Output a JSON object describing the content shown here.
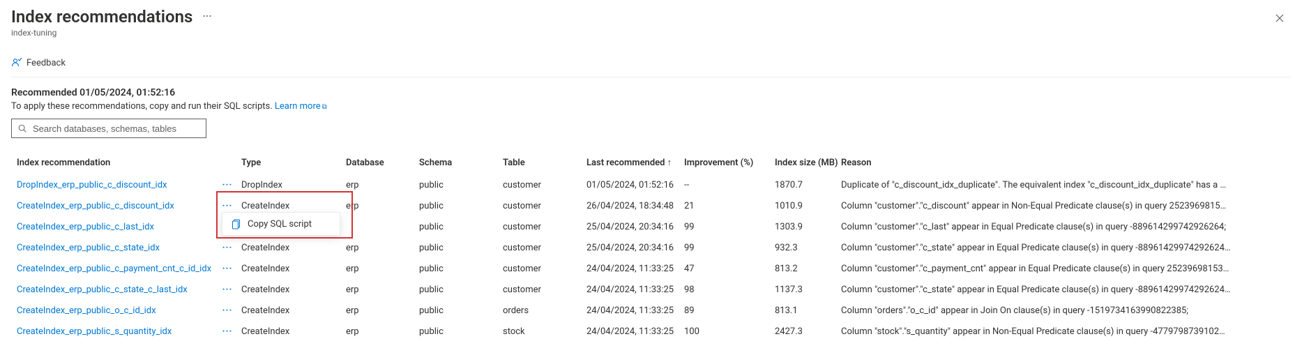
{
  "header": {
    "title": "Index recommendations",
    "subtitle": "index-tuning",
    "feedback_label": "Feedback",
    "close_label": "Close"
  },
  "summary": {
    "recommended_prefix": "Recommended ",
    "recommended_timestamp": "01/05/2024, 01:52:16",
    "apply_text": "To apply these recommendations, copy and run their SQL scripts. ",
    "learn_more_label": "Learn more"
  },
  "search": {
    "placeholder": "Search databases, schemas, tables",
    "value": ""
  },
  "columns": {
    "name": "Index recommendation",
    "type": "Type",
    "database": "Database",
    "schema": "Schema",
    "table": "Table",
    "last_recommended": "Last recommended ↑",
    "improvement": "Improvement (%)",
    "index_size": "Index size (MB)",
    "reason": "Reason"
  },
  "context_menu": {
    "copy_sql": "Copy SQL script"
  },
  "rows": [
    {
      "name": "DropIndex_erp_public_c_discount_idx",
      "type": "DropIndex",
      "database": "erp",
      "schema": "public",
      "table": "customer",
      "last": "01/05/2024, 01:52:16",
      "improvement": "--",
      "size": "1870.7",
      "reason": "Duplicate of \"c_discount_idx_duplicate\". The equivalent index \"c_discount_idx_duplicate\" has a …"
    },
    {
      "name": "CreateIndex_erp_public_c_discount_idx",
      "type": "CreateIndex",
      "database": "erp",
      "schema": "public",
      "table": "customer",
      "last": "26/04/2024, 18:34:48",
      "improvement": "21",
      "size": "1010.9",
      "reason": "Column \"customer\".\"c_discount\" appear in Non-Equal Predicate clause(s) in query 2523969815…"
    },
    {
      "name": "CreateIndex_erp_public_c_last_idx",
      "type": "",
      "database": "",
      "schema": "public",
      "table": "customer",
      "last": "25/04/2024, 20:34:16",
      "improvement": "99",
      "size": "1303.9",
      "reason": "Column \"customer\".\"c_last\" appear in Equal Predicate clause(s) in query -889614299742926264;"
    },
    {
      "name": "CreateIndex_erp_public_c_state_idx",
      "type": "CreateIndex",
      "database": "erp",
      "schema": "public",
      "table": "customer",
      "last": "25/04/2024, 20:34:16",
      "improvement": "99",
      "size": "932.3",
      "reason": "Column \"customer\".\"c_state\" appear in Equal Predicate clause(s) in query -88961429974292624…"
    },
    {
      "name": "CreateIndex_erp_public_c_payment_cnt_c_id_idx",
      "type": "CreateIndex",
      "database": "erp",
      "schema": "public",
      "table": "customer",
      "last": "24/04/2024, 11:33:25",
      "improvement": "47",
      "size": "813.2",
      "reason": "Column \"customer\".\"c_payment_cnt\" appear in Equal Predicate clause(s) in query 25239698153…"
    },
    {
      "name": "CreateIndex_erp_public_c_state_c_last_idx",
      "type": "CreateIndex",
      "database": "erp",
      "schema": "public",
      "table": "customer",
      "last": "24/04/2024, 11:33:25",
      "improvement": "98",
      "size": "1137.3",
      "reason": "Column \"customer\".\"c_state\" appear in Equal Predicate clause(s) in query -88961429974292624…"
    },
    {
      "name": "CreateIndex_erp_public_o_c_id_idx",
      "type": "CreateIndex",
      "database": "erp",
      "schema": "public",
      "table": "orders",
      "last": "24/04/2024, 11:33:25",
      "improvement": "89",
      "size": "813.1",
      "reason": "Column \"orders\".\"o_c_id\" appear in Join On clause(s) in query -1519734163990822385;"
    },
    {
      "name": "CreateIndex_erp_public_s_quantity_idx",
      "type": "CreateIndex",
      "database": "erp",
      "schema": "public",
      "table": "stock",
      "last": "24/04/2024, 11:33:25",
      "improvement": "100",
      "size": "2427.3",
      "reason": "Column \"stock\".\"s_quantity\" appear in Non-Equal Predicate clause(s) in query -4779798739102…"
    }
  ]
}
